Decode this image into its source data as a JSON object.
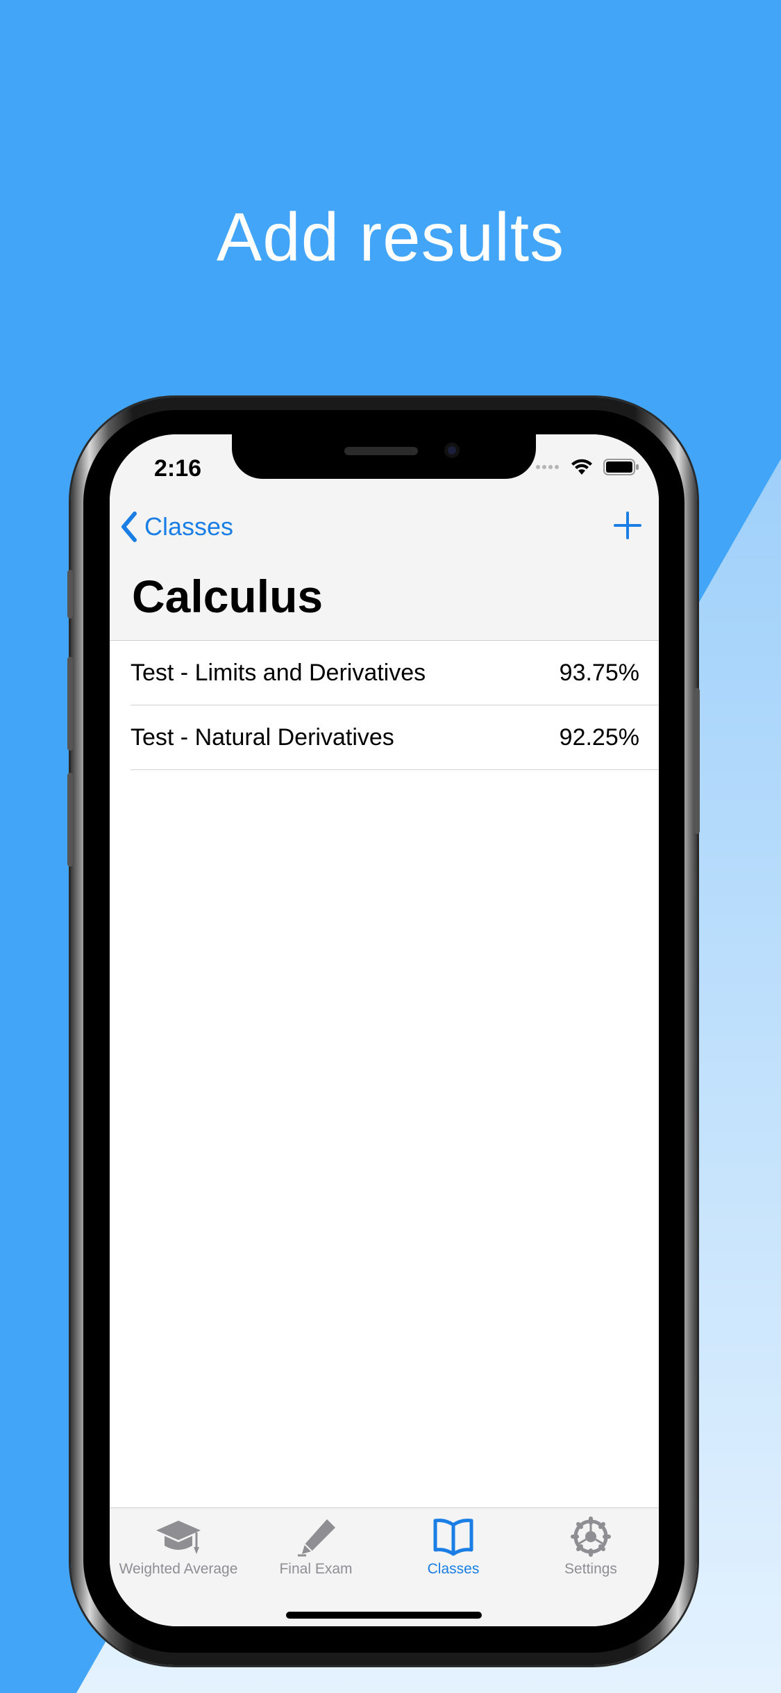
{
  "headline": "Add results",
  "status_bar": {
    "time": "2:16"
  },
  "nav": {
    "back_label": "Classes",
    "title": "Calculus"
  },
  "results": [
    {
      "name": "Test - Limits and Derivatives",
      "score": "93.75%"
    },
    {
      "name": "Test - Natural Derivatives",
      "score": "92.25%"
    }
  ],
  "tabs": [
    {
      "label": "Weighted Average",
      "icon": "graduation-cap-icon",
      "active": false
    },
    {
      "label": "Final Exam",
      "icon": "pen-icon",
      "active": false
    },
    {
      "label": "Classes",
      "icon": "book-icon",
      "active": true
    },
    {
      "label": "Settings",
      "icon": "gear-icon",
      "active": false
    }
  ],
  "colors": {
    "background": "#42a5f7",
    "accent": "#1a7ee4",
    "inactive_tab": "#8e8e93"
  }
}
